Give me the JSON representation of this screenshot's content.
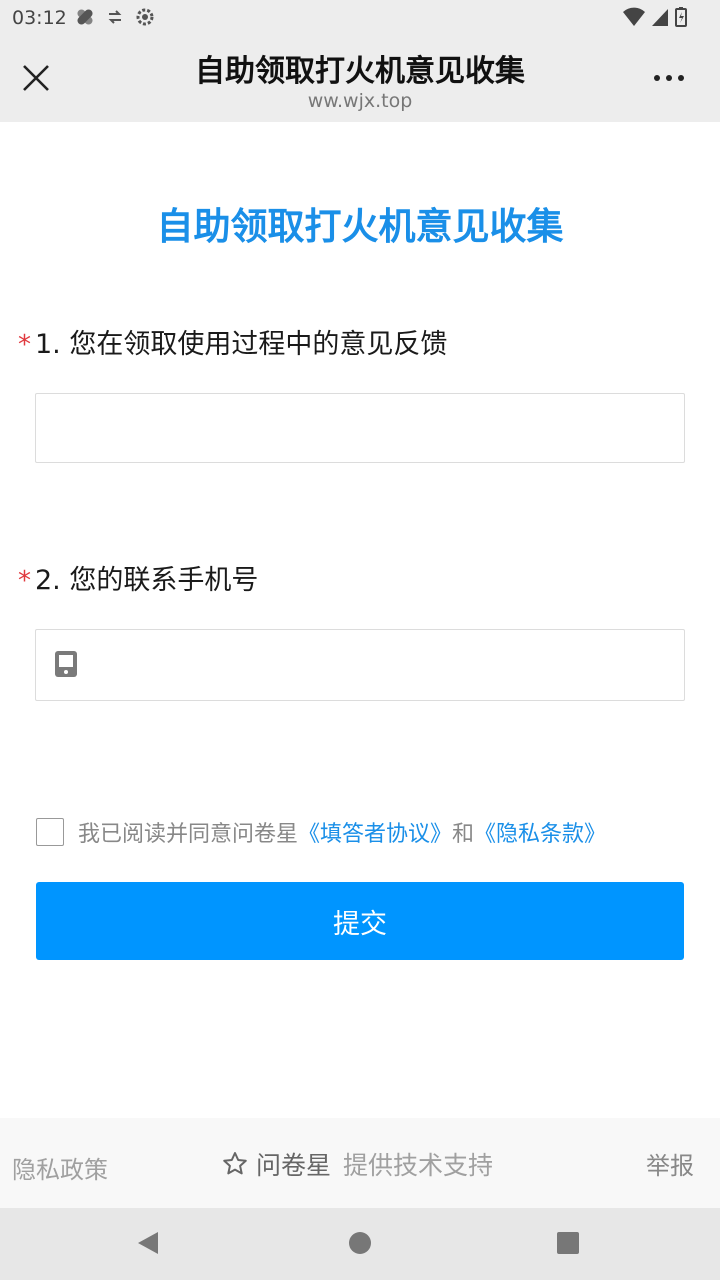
{
  "status": {
    "time": "03:12"
  },
  "nav": {
    "title": "自助领取打火机意见收集",
    "url": "ww.wjx.top"
  },
  "survey": {
    "title": "自助领取打火机意见收集",
    "questions": [
      {
        "required_mark": "*",
        "label": "1. 您在领取使用过程中的意见反馈"
      },
      {
        "required_mark": "*",
        "label": "2. 您的联系手机号"
      }
    ]
  },
  "agreement": {
    "prefix": "我已阅读并同意问卷星",
    "link1": "《填答者协议》",
    "conj": "和",
    "link2": "《隐私条款》"
  },
  "submit_label": "提交",
  "footer": {
    "privacy": "隐私政策",
    "brand": "问卷星",
    "support": "提供技术支持",
    "report": "举报"
  },
  "colors": {
    "accent": "#1a8fe8",
    "button": "#0095ff",
    "required": "#e0393e"
  }
}
